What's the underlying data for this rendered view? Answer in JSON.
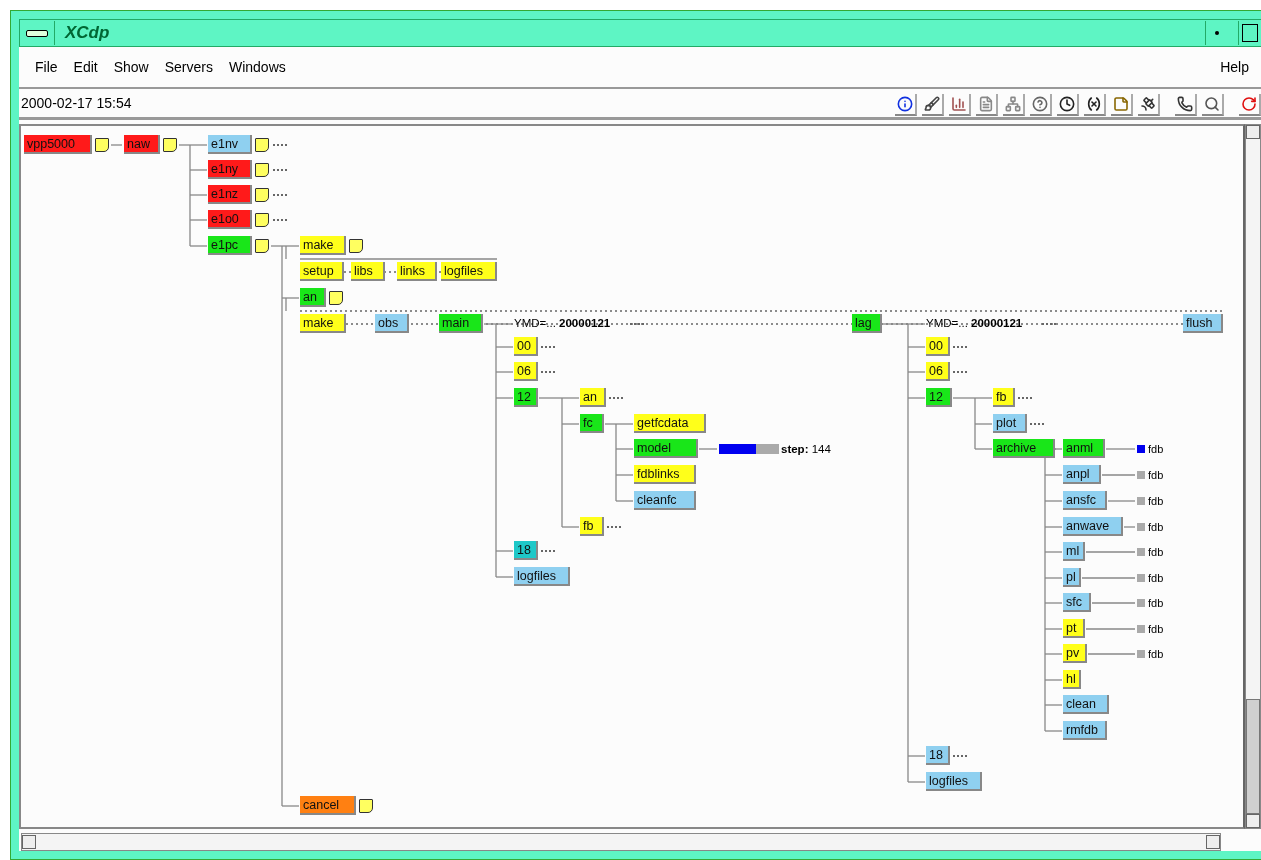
{
  "window": {
    "title": "XCdp"
  },
  "menu": [
    {
      "label": "File"
    },
    {
      "label": "Edit"
    },
    {
      "label": "Show"
    },
    {
      "label": "Servers"
    },
    {
      "label": "Windows"
    }
  ],
  "help": "Help",
  "status_time": "2000-02-17 15:54",
  "tree": {
    "kind": "node",
    "name": "vpp5000",
    "color": "#ff1a1a",
    "note": true,
    "children": [
      {
        "kind": "node",
        "name": "naw",
        "color": "#ff1a1a",
        "note": true,
        "children": [
          {
            "kind": "node",
            "name": "e1nv",
            "color": "#8fd0f0",
            "note": true,
            "collapsed": true
          },
          {
            "kind": "node",
            "name": "e1ny",
            "color": "#ff1a1a",
            "note": true,
            "collapsed": true
          },
          {
            "kind": "node",
            "name": "e1nz",
            "color": "#ff1a1a",
            "note": true,
            "collapsed": true
          },
          {
            "kind": "node",
            "name": "e1o0",
            "color": "#ff1a1a",
            "note": true,
            "collapsed": true
          },
          {
            "kind": "node",
            "name": "e1pc",
            "color": "#19e619",
            "note": true,
            "children": [
              {
                "kind": "node",
                "name": "make",
                "color": "#ffff1a",
                "note": true,
                "children": [
                  {
                    "kind": "node",
                    "name": "setup",
                    "color": "#ffff1a"
                  },
                  {
                    "kind": "node",
                    "name": "libs",
                    "color": "#ffff1a"
                  },
                  {
                    "kind": "node",
                    "name": "links",
                    "color": "#ffff1a"
                  },
                  {
                    "kind": "node",
                    "name": "logfiles",
                    "color": "#ffff1a"
                  }
                ]
              },
              {
                "kind": "node",
                "name": "an",
                "color": "#19e619",
                "note": true,
                "children": [
                  {
                    "kind": "node",
                    "name": "make",
                    "color": "#ffff1a"
                  },
                  {
                    "kind": "node",
                    "name": "obs",
                    "color": "#8fd0f0"
                  },
                  {
                    "kind": "node",
                    "name": "main",
                    "color": "#19e619",
                    "children": [
                      {
                        "kind": "repeat",
                        "label": "YMD=... **20000121**",
                        "collapsed": true
                      },
                      {
                        "kind": "node",
                        "name": "00",
                        "color": "#ffff1a",
                        "collapsed": true
                      },
                      {
                        "kind": "node",
                        "name": "06",
                        "color": "#ffff1a",
                        "collapsed": true
                      },
                      {
                        "kind": "node",
                        "name": "12",
                        "color": "#19e619",
                        "children": [
                          {
                            "kind": "node",
                            "name": "an",
                            "color": "#ffff1a",
                            "collapsed": true
                          },
                          {
                            "kind": "node",
                            "name": "fc",
                            "color": "#19e619",
                            "children": [
                              {
                                "kind": "node",
                                "name": "getfcdata",
                                "color": "#ffff1a"
                              },
                              {
                                "kind": "node",
                                "name": "model",
                                "color": "#19e619",
                                "children": [
                                  {
                                    "kind": "meter",
                                    "label": "**step:** 144",
                                    "level": 0.62
                                  }
                                ]
                              },
                              {
                                "kind": "node",
                                "name": "fdblinks",
                                "color": "#ffff1a"
                              },
                              {
                                "kind": "node",
                                "name": "cleanfc",
                                "color": "#8fd0f0"
                              }
                            ]
                          },
                          {
                            "kind": "node",
                            "name": "fb",
                            "color": "#ffff1a",
                            "collapsed": true
                          }
                        ]
                      },
                      {
                        "kind": "node",
                        "name": "18",
                        "color": "#1ec8c8",
                        "collapsed": true
                      },
                      {
                        "kind": "node",
                        "name": "logfiles",
                        "color": "#8fd0f0"
                      }
                    ]
                  },
                  {
                    "kind": "node",
                    "name": "lag",
                    "color": "#19e619",
                    "children": [
                      {
                        "kind": "repeat",
                        "label": "YMD=... **20000121**",
                        "collapsed": true
                      },
                      {
                        "kind": "node",
                        "name": "00",
                        "color": "#ffff1a",
                        "collapsed": true
                      },
                      {
                        "kind": "node",
                        "name": "06",
                        "color": "#ffff1a",
                        "collapsed": true
                      },
                      {
                        "kind": "node",
                        "name": "12",
                        "color": "#19e619",
                        "children": [
                          {
                            "kind": "node",
                            "name": "fb",
                            "color": "#ffff1a",
                            "collapsed": true
                          },
                          {
                            "kind": "node",
                            "name": "plot",
                            "color": "#8fd0f0",
                            "collapsed": true
                          },
                          {
                            "kind": "node",
                            "name": "archive",
                            "color": "#19e619",
                            "children": [
                              {
                                "kind": "node",
                                "name": "anml",
                                "color": "#19e619",
                                "children": [
                                  {
                                    "kind": "event",
                                    "label": "fdb",
                                    "set": true
                                  }
                                ]
                              },
                              {
                                "kind": "node",
                                "name": "anpl",
                                "color": "#8fd0f0",
                                "children": [
                                  {
                                    "kind": "event",
                                    "label": "fdb",
                                    "set": false
                                  }
                                ]
                              },
                              {
                                "kind": "node",
                                "name": "ansfc",
                                "color": "#8fd0f0",
                                "children": [
                                  {
                                    "kind": "event",
                                    "label": "fdb",
                                    "set": false
                                  }
                                ]
                              },
                              {
                                "kind": "node",
                                "name": "anwave",
                                "color": "#8fd0f0",
                                "children": [
                                  {
                                    "kind": "event",
                                    "label": "fdb",
                                    "set": false
                                  }
                                ]
                              },
                              {
                                "kind": "node",
                                "name": "ml",
                                "color": "#8fd0f0",
                                "children": [
                                  {
                                    "kind": "event",
                                    "label": "fdb",
                                    "set": false
                                  }
                                ]
                              },
                              {
                                "kind": "node",
                                "name": "pl",
                                "color": "#8fd0f0",
                                "children": [
                                  {
                                    "kind": "event",
                                    "label": "fdb",
                                    "set": false
                                  }
                                ]
                              },
                              {
                                "kind": "node",
                                "name": "sfc",
                                "color": "#8fd0f0",
                                "children": [
                                  {
                                    "kind": "event",
                                    "label": "fdb",
                                    "set": false
                                  }
                                ]
                              },
                              {
                                "kind": "node",
                                "name": "pt",
                                "color": "#ffff1a",
                                "children": [
                                  {
                                    "kind": "event",
                                    "label": "fdb",
                                    "set": false
                                  }
                                ]
                              },
                              {
                                "kind": "node",
                                "name": "pv",
                                "color": "#ffff1a",
                                "children": [
                                  {
                                    "kind": "event",
                                    "label": "fdb",
                                    "set": false
                                  }
                                ]
                              },
                              {
                                "kind": "node",
                                "name": "hl",
                                "color": "#ffff1a"
                              },
                              {
                                "kind": "node",
                                "name": "clean",
                                "color": "#8fd0f0"
                              },
                              {
                                "kind": "node",
                                "name": "rmfdb",
                                "color": "#8fd0f0"
                              }
                            ]
                          }
                        ]
                      },
                      {
                        "kind": "node",
                        "name": "18",
                        "color": "#8fd0f0",
                        "collapsed": true
                      },
                      {
                        "kind": "node",
                        "name": "logfiles",
                        "color": "#8fd0f0"
                      }
                    ]
                  },
                  {
                    "kind": "node",
                    "name": "flush",
                    "color": "#8fd0f0"
                  }
                ]
              },
              {
                "kind": "node",
                "name": "cancel",
                "color": "#ff8012",
                "note": true
              }
            ]
          }
        ]
      }
    ]
  }
}
